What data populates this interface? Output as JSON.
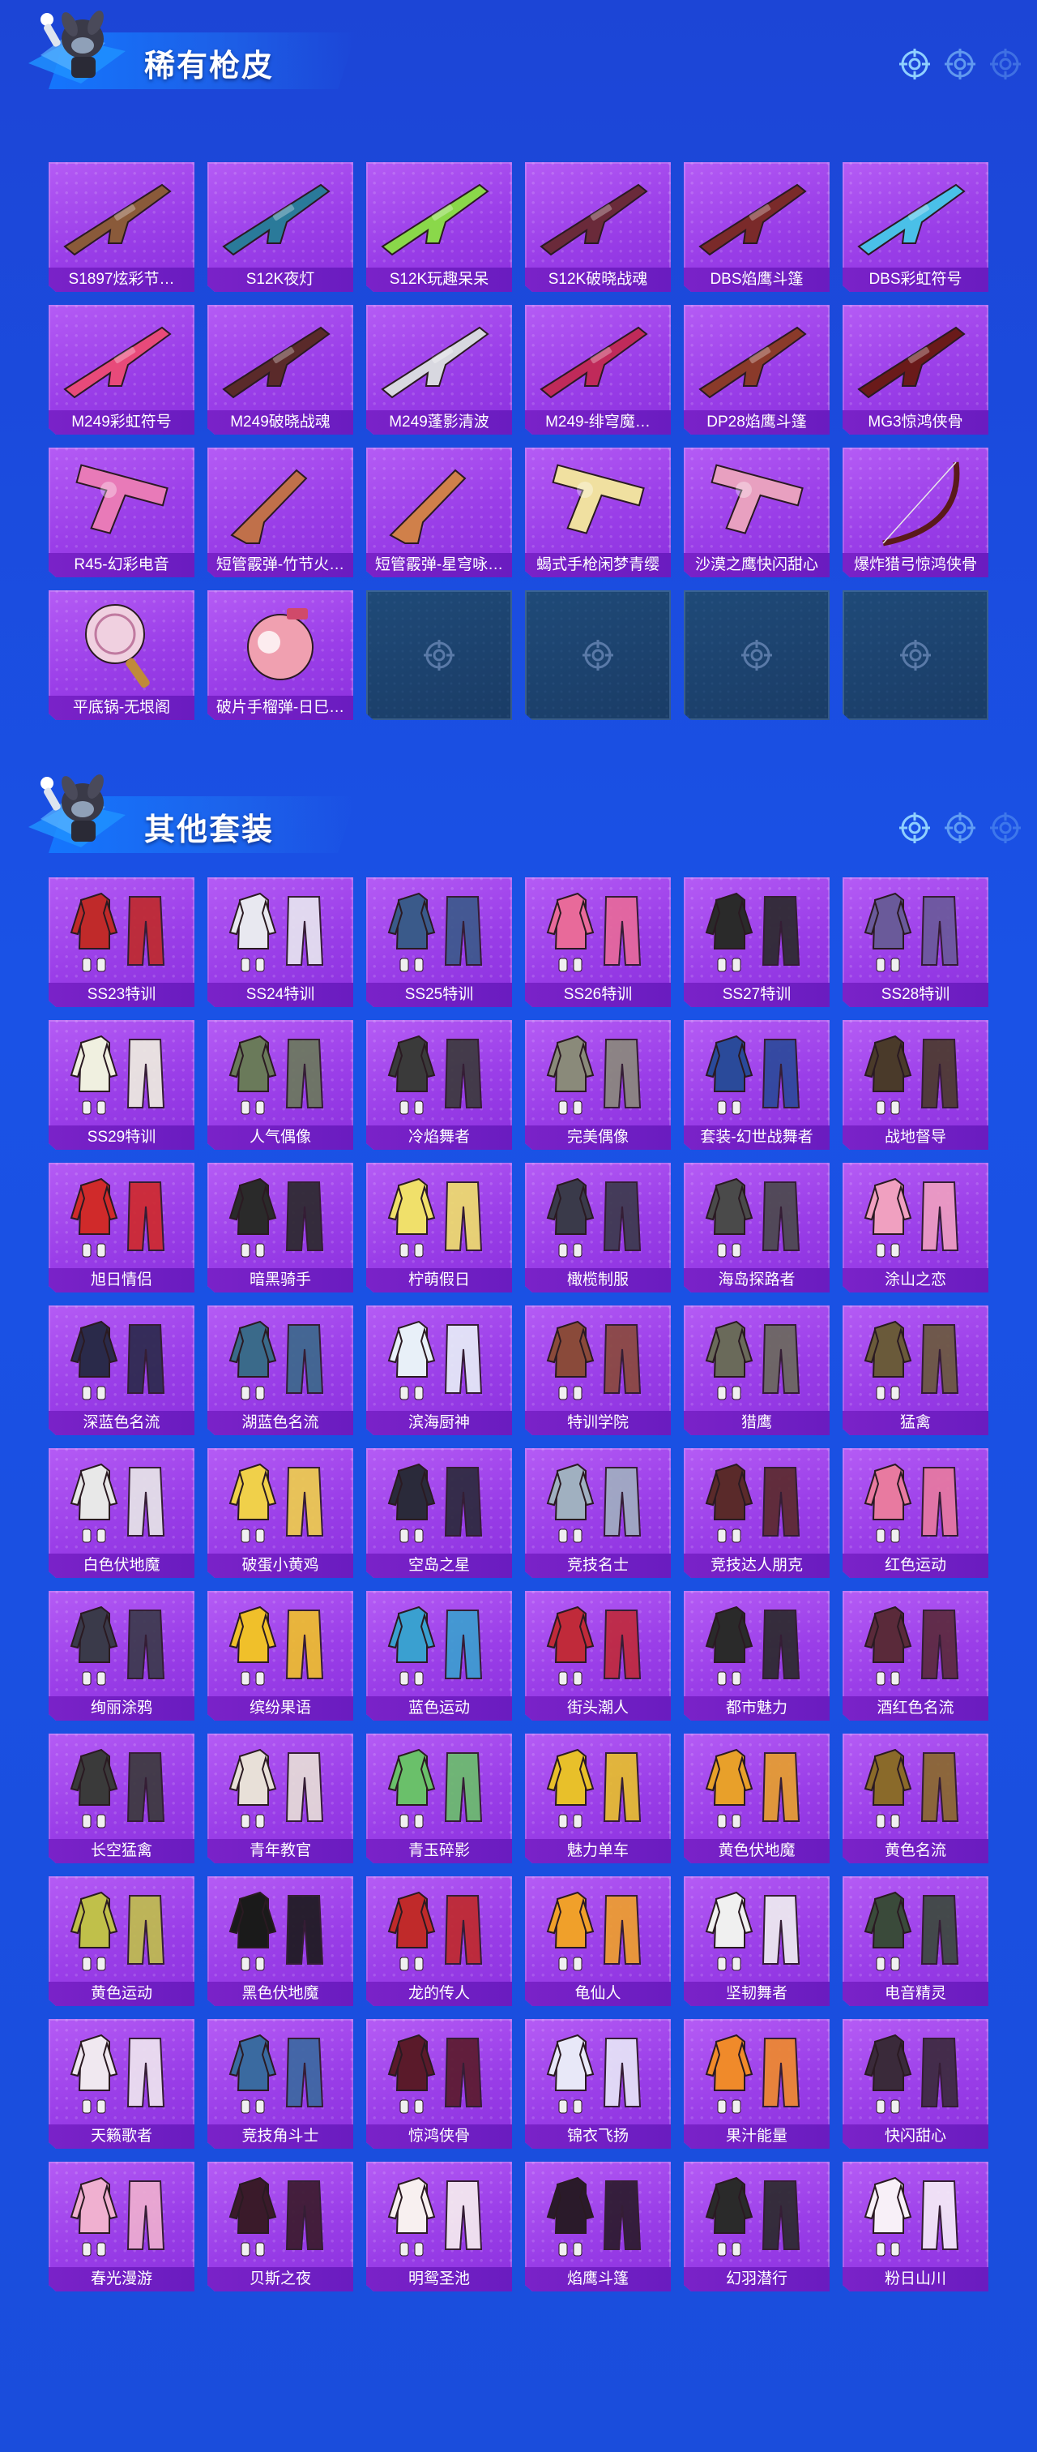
{
  "sections": [
    {
      "title": "稀有枪皮",
      "items": [
        {
          "label": "S1897炫彩节…",
          "icon": "shotgun-icon",
          "color": "#8a5a3a"
        },
        {
          "label": "S12K夜灯",
          "icon": "rifle-icon",
          "color": "#2a7a9a"
        },
        {
          "label": "S12K玩趣呆呆",
          "icon": "rifle-icon",
          "color": "#8ad84a"
        },
        {
          "label": "S12K破晓战魂",
          "icon": "rifle-icon",
          "color": "#6a2a3a"
        },
        {
          "label": "DBS焰鹰斗篷",
          "icon": "shotgun-icon",
          "color": "#7a2a2a"
        },
        {
          "label": "DBS彩虹符号",
          "icon": "shotgun-icon",
          "color": "#4ac0e8"
        },
        {
          "label": "M249彩虹符号",
          "icon": "machinegun-icon",
          "color": "#e84a7a"
        },
        {
          "label": "M249破晓战魂",
          "icon": "machinegun-icon",
          "color": "#5a2a2a"
        },
        {
          "label": "M249蓬影清波",
          "icon": "machinegun-icon",
          "color": "#d8d8e0"
        },
        {
          "label": "M249-绯穹魔…",
          "icon": "machinegun-icon",
          "color": "#c02a5a"
        },
        {
          "label": "DP28焰鹰斗篷",
          "icon": "machinegun-icon",
          "color": "#8a3a2a"
        },
        {
          "label": "MG3惊鸿侠骨",
          "icon": "machinegun-icon",
          "color": "#6a1a1a"
        },
        {
          "label": "R45-幻彩电音",
          "icon": "revolver-icon",
          "color": "#e87ab8"
        },
        {
          "label": "短管霰弹-竹节火…",
          "icon": "sawedoff-icon",
          "color": "#c0704a"
        },
        {
          "label": "短管霰弹-星穹咏…",
          "icon": "sawedoff-icon",
          "color": "#d0804a"
        },
        {
          "label": "蝎式手枪闲梦青缨",
          "icon": "smg-icon",
          "color": "#f0e0a0"
        },
        {
          "label": "沙漠之鹰快闪甜心",
          "icon": "pistol-icon",
          "color": "#e8a0c0"
        },
        {
          "label": "爆炸猎弓惊鸿侠骨",
          "icon": "bow-icon",
          "color": "#5a1a1a"
        },
        {
          "label": "平底锅-无垠阁",
          "icon": "pan-icon",
          "color": "#f0d0e0"
        },
        {
          "label": "破片手榴弹-日巳…",
          "icon": "grenade-icon",
          "color": "#f0a0b0"
        }
      ],
      "empty_slots": 4
    },
    {
      "title": "其他套装",
      "items": [
        {
          "label": "SS23特训",
          "icon": "outfit-icon",
          "color": "#c02a2a"
        },
        {
          "label": "SS24特训",
          "icon": "outfit-icon",
          "color": "#e8e8f0"
        },
        {
          "label": "SS25特训",
          "icon": "outfit-icon",
          "color": "#3a5a8a"
        },
        {
          "label": "SS26特训",
          "icon": "outfit-icon",
          "color": "#e86a9a"
        },
        {
          "label": "SS27特训",
          "icon": "outfit-icon",
          "color": "#2a2a2a"
        },
        {
          "label": "SS28特训",
          "icon": "outfit-icon",
          "color": "#6a5a9a"
        },
        {
          "label": "SS29特训",
          "icon": "outfit-icon",
          "color": "#f0f0e0"
        },
        {
          "label": "人气偶像",
          "icon": "outfit-icon",
          "color": "#6a7a5a"
        },
        {
          "label": "冷焰舞者",
          "icon": "outfit-icon",
          "color": "#3a3a3a"
        },
        {
          "label": "完美偶像",
          "icon": "outfit-icon",
          "color": "#8a8a7a"
        },
        {
          "label": "套装-幻世战舞者",
          "icon": "outfit-icon",
          "color": "#2a4a9a"
        },
        {
          "label": "战地督导",
          "icon": "outfit-icon",
          "color": "#4a3a2a"
        },
        {
          "label": "旭日情侣",
          "icon": "outfit-icon",
          "color": "#d02a2a"
        },
        {
          "label": "暗黑骑手",
          "icon": "outfit-icon",
          "color": "#2a2a2a"
        },
        {
          "label": "柠萌假日",
          "icon": "outfit-icon",
          "color": "#f0e06a"
        },
        {
          "label": "橄榄制服",
          "icon": "outfit-icon",
          "color": "#3a3a4a"
        },
        {
          "label": "海岛探路者",
          "icon": "outfit-icon",
          "color": "#4a4a4a"
        },
        {
          "label": "涂山之恋",
          "icon": "outfit-icon",
          "color": "#f0a0c0"
        },
        {
          "label": "深蓝色名流",
          "icon": "outfit-icon",
          "color": "#2a2a4a"
        },
        {
          "label": "湖蓝色名流",
          "icon": "outfit-icon",
          "color": "#3a6a8a"
        },
        {
          "label": "滨海厨神",
          "icon": "outfit-icon",
          "color": "#e8f0f8"
        },
        {
          "label": "特训学院",
          "icon": "outfit-icon",
          "color": "#8a4a3a"
        },
        {
          "label": "猎鹰",
          "icon": "outfit-icon",
          "color": "#6a6a5a"
        },
        {
          "label": "猛禽",
          "icon": "outfit-icon",
          "color": "#6a5a3a"
        },
        {
          "label": "白色伏地魔",
          "icon": "outfit-icon",
          "color": "#e8e8e8"
        },
        {
          "label": "破蛋小黄鸡",
          "icon": "outfit-icon",
          "color": "#f0d04a"
        },
        {
          "label": "空岛之星",
          "icon": "outfit-icon",
          "color": "#2a2a3a"
        },
        {
          "label": "竞技名士",
          "icon": "outfit-icon",
          "color": "#a0b0c0"
        },
        {
          "label": "竞技达人朋克",
          "icon": "outfit-icon",
          "color": "#5a2a2a"
        },
        {
          "label": "红色运动",
          "icon": "outfit-icon",
          "color": "#e87aa0"
        },
        {
          "label": "绚丽涂鸦",
          "icon": "outfit-icon",
          "color": "#3a3a4a"
        },
        {
          "label": "缤纷果语",
          "icon": "outfit-icon",
          "color": "#f0c02a"
        },
        {
          "label": "蓝色运动",
          "icon": "outfit-icon",
          "color": "#3aa0d0"
        },
        {
          "label": "街头潮人",
          "icon": "outfit-icon",
          "color": "#c02a3a"
        },
        {
          "label": "都市魅力",
          "icon": "outfit-icon",
          "color": "#2a2a2a"
        },
        {
          "label": "酒红色名流",
          "icon": "outfit-icon",
          "color": "#5a2a3a"
        },
        {
          "label": "长空猛禽",
          "icon": "outfit-icon",
          "color": "#3a3a3a"
        },
        {
          "label": "青年教官",
          "icon": "outfit-icon",
          "color": "#e8e0d8"
        },
        {
          "label": "青玉碎影",
          "icon": "outfit-icon",
          "color": "#6ac06a"
        },
        {
          "label": "魅力单车",
          "icon": "outfit-icon",
          "color": "#e8c02a"
        },
        {
          "label": "黄色伏地魔",
          "icon": "outfit-icon",
          "color": "#e8a02a"
        },
        {
          "label": "黄色名流",
          "icon": "outfit-icon",
          "color": "#8a6a2a"
        },
        {
          "label": "黄色运动",
          "icon": "outfit-icon",
          "color": "#c0c04a"
        },
        {
          "label": "黑色伏地魔",
          "icon": "outfit-icon",
          "color": "#1a1a1a"
        },
        {
          "label": "龙的传人",
          "icon": "outfit-icon",
          "color": "#c02a2a"
        },
        {
          "label": "龟仙人",
          "icon": "outfit-icon",
          "color": "#f0a02a"
        },
        {
          "label": "坚韧舞者",
          "icon": "outfit-icon",
          "color": "#f0f0f0"
        },
        {
          "label": "电音精灵",
          "icon": "outfit-icon",
          "color": "#3a4a3a"
        },
        {
          "label": "天籁歌者",
          "icon": "outfit-icon",
          "color": "#f0e8f0"
        },
        {
          "label": "竞技角斗士",
          "icon": "outfit-icon",
          "color": "#3a6aa0"
        },
        {
          "label": "惊鸿侠骨",
          "icon": "outfit-icon",
          "color": "#5a1a2a"
        },
        {
          "label": "锦衣飞扬",
          "icon": "outfit-icon",
          "color": "#e8e8f8"
        },
        {
          "label": "果汁能量",
          "icon": "outfit-icon",
          "color": "#f08a2a"
        },
        {
          "label": "快闪甜心",
          "icon": "outfit-icon",
          "color": "#3a2a3a"
        },
        {
          "label": "春光漫游",
          "icon": "outfit-icon",
          "color": "#f0b0d0"
        },
        {
          "label": "贝斯之夜",
          "icon": "outfit-icon",
          "color": "#3a1a2a"
        },
        {
          "label": "明鸳圣池",
          "icon": "outfit-icon",
          "color": "#f8f0f0"
        },
        {
          "label": "焰鹰斗篷",
          "icon": "outfit-icon",
          "color": "#2a1a2a"
        },
        {
          "label": "幻羽潜行",
          "icon": "outfit-icon",
          "color": "#2a2a2a"
        },
        {
          "label": "粉日山川",
          "icon": "outfit-icon",
          "color": "#f8f0f8"
        }
      ],
      "empty_slots": 0
    }
  ]
}
